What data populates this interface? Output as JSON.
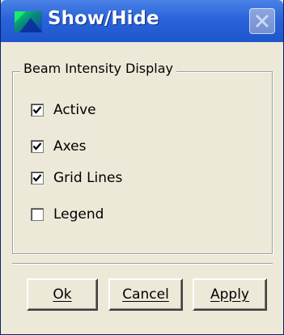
{
  "window": {
    "title": "Show/Hide",
    "icon": "app-color-icon",
    "close_icon": "close-icon"
  },
  "group": {
    "legend": "Beam Intensity Display",
    "options": [
      {
        "label": "Active",
        "checked": true
      },
      {
        "label": "Axes",
        "checked": true
      },
      {
        "label": "Grid Lines",
        "checked": true
      },
      {
        "label": "Legend",
        "checked": false
      }
    ]
  },
  "buttons": {
    "ok": "Ok",
    "cancel": "Cancel",
    "apply": "Apply"
  },
  "colors": {
    "titlebar": "#2a63da",
    "background": "#ece9d8",
    "title_text": "#ffffff"
  }
}
